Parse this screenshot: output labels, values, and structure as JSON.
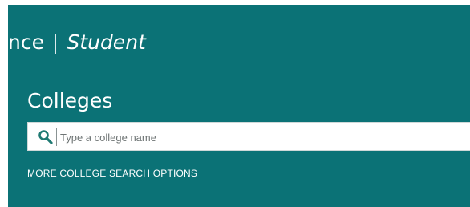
{
  "header": {
    "brand_left": "nce",
    "separator": "|",
    "brand_right": "Student"
  },
  "search": {
    "title": "Colleges",
    "placeholder": "Type a college name",
    "value": "",
    "icon": "search-icon"
  },
  "links": {
    "more_options": "MORE COLLEGE SEARCH OPTIONS"
  },
  "colors": {
    "panel_background": "#0b7276",
    "icon_color": "#1f7a73"
  }
}
